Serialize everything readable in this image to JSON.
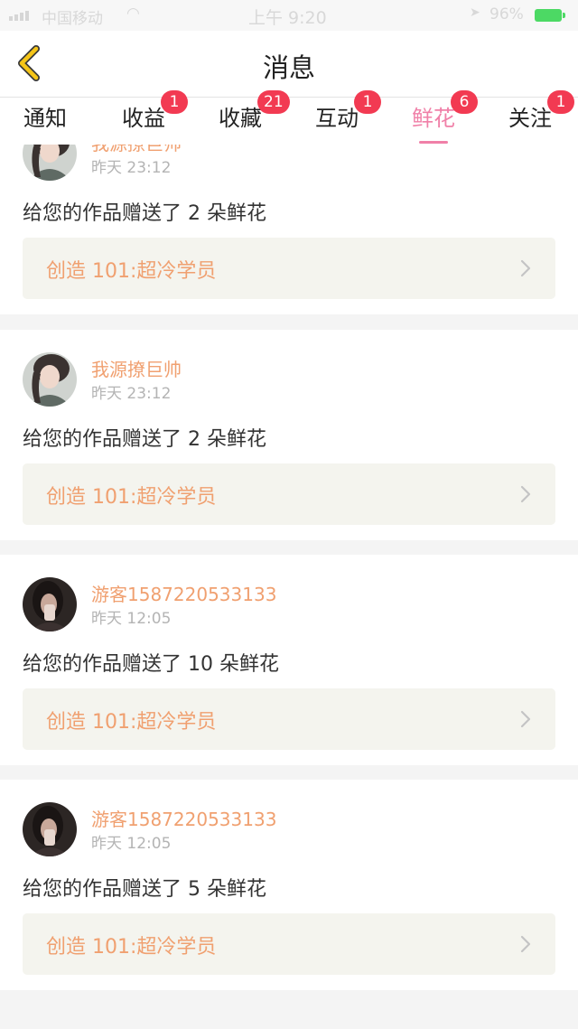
{
  "status_bar": {
    "carrier": "中国移动",
    "time": "上午 9:20",
    "battery": "96%"
  },
  "header": {
    "title": "消息"
  },
  "tabs": [
    {
      "label": "通知",
      "badge": ""
    },
    {
      "label": "收益",
      "badge": "1"
    },
    {
      "label": "收藏",
      "badge": "21"
    },
    {
      "label": "互动",
      "badge": "1"
    },
    {
      "label": "鲜花",
      "badge": "6",
      "active": true
    },
    {
      "label": "关注",
      "badge": "1"
    }
  ],
  "messages": [
    {
      "name": "我源撩巨帅",
      "time": "昨天 23:12",
      "text": "给您的作品赠送了 2 朵鲜花",
      "work": "创造 101:超冷学员"
    },
    {
      "name": "我源撩巨帅",
      "time": "昨天 23:12",
      "text": "给您的作品赠送了 2 朵鲜花",
      "work": "创造 101:超冷学员"
    },
    {
      "name": "游客1587220533133",
      "time": "昨天 12:05",
      "text": "给您的作品赠送了 10 朵鲜花",
      "work": "创造 101:超冷学员"
    },
    {
      "name": "游客1587220533133",
      "time": "昨天 12:05",
      "text": "给您的作品赠送了 5 朵鲜花",
      "work": "创造 101:超冷学员"
    }
  ],
  "colors": {
    "accent_pink": "#f080a8",
    "name_orange": "#f0a070",
    "badge_red": "#f23a52",
    "back_yellow": "#f5c518"
  },
  "icons": {
    "back": "chevron-left-icon",
    "row_arrow": "chevron-right-icon",
    "signal": "signal-icon",
    "wifi": "wifi-icon",
    "location": "location-arrow-icon",
    "battery": "battery-charging-icon"
  }
}
